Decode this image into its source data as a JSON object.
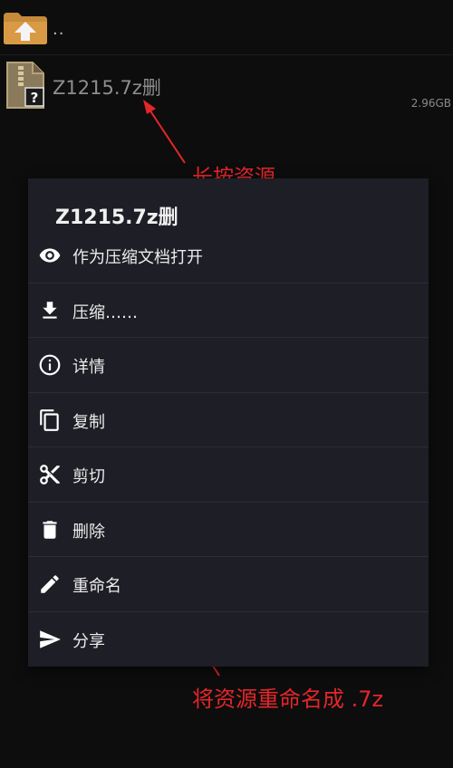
{
  "file_list": {
    "up_label": "..",
    "file": {
      "name": "Z1215.7z删",
      "size": "2.96GB"
    }
  },
  "context_menu": {
    "title": "Z1215.7z删",
    "items": [
      {
        "label": "作为压缩文档打开",
        "icon": "eye-icon"
      },
      {
        "label": "压缩……",
        "icon": "download-icon"
      },
      {
        "label": "详情",
        "icon": "info-icon"
      },
      {
        "label": "复制",
        "icon": "copy-icon"
      },
      {
        "label": "剪切",
        "icon": "scissors-icon"
      },
      {
        "label": "删除",
        "icon": "trash-icon"
      },
      {
        "label": "重命名",
        "icon": "pencil-icon"
      },
      {
        "label": "分享",
        "icon": "send-icon"
      }
    ]
  },
  "annotations": {
    "long_press": "长按资源",
    "rename_hint": "将资源重命名成 .7z"
  },
  "colors": {
    "background": "#0d0d0d",
    "menu_background": "#1e1e26",
    "annotation": "#e4262a",
    "folder": "#c58a3a"
  }
}
